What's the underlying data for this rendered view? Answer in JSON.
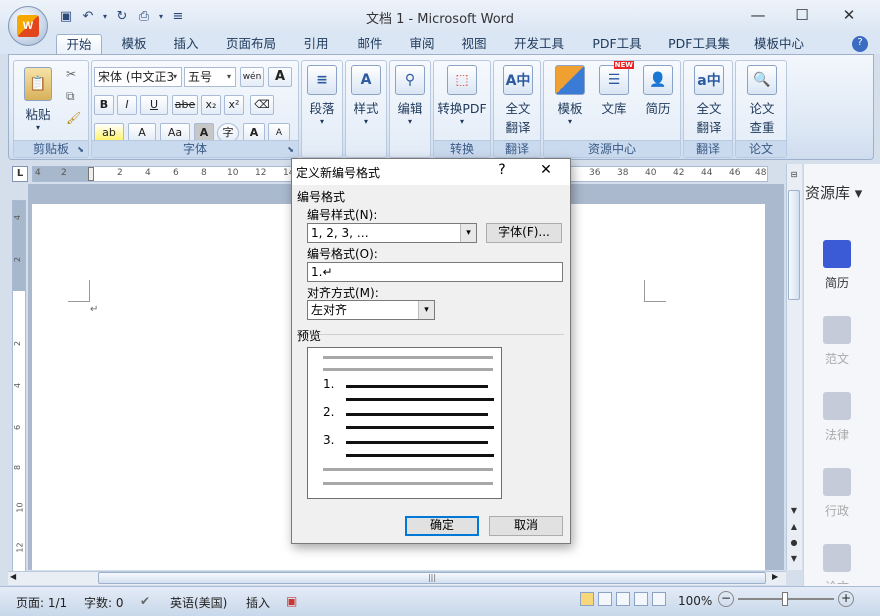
{
  "window": {
    "title": "文档 1 - Microsoft Word",
    "controls": [
      "—",
      "☐",
      "✕"
    ]
  },
  "office_button": {
    "logo": "W"
  },
  "quick_access": [
    "save-icon",
    "undo-icon",
    "redo-icon",
    "print-icon",
    "customize-icon"
  ],
  "tabs": [
    "开始",
    "模板",
    "插入",
    "页面布局",
    "引用",
    "邮件",
    "审阅",
    "视图",
    "开发工具",
    "PDF工具",
    "PDF工具集",
    "模板中心"
  ],
  "active_tab": "开始",
  "ribbon": {
    "clipboard": {
      "label": "剪贴板",
      "paste": "粘贴"
    },
    "font": {
      "label": "字体",
      "font_name": "宋体 (中文正3",
      "font_size": "五号",
      "wen": "wén",
      "bold": "B",
      "italic": "I",
      "underline": "U",
      "strike": "abe",
      "sub": "x₂",
      "sup": "x²",
      "aa": "Aa",
      "grow": "A",
      "shrink": "A"
    },
    "paragraph": {
      "label": "段落"
    },
    "styles": {
      "label": "样式"
    },
    "editing": {
      "label": "编辑"
    },
    "to_pdf": {
      "label": "转换",
      "button": "转换PDF"
    },
    "translate": {
      "label": "翻译",
      "button_line1": "全文",
      "button_line2": "翻译"
    },
    "resource": {
      "label": "资源中心",
      "template": "模板",
      "library": "文库",
      "resume": "简历",
      "new_badge": "NEW"
    },
    "translate2": {
      "label": "翻译",
      "button_line1": "全文",
      "button_line2": "翻译"
    },
    "paper": {
      "label": "论文",
      "button_line1": "论文",
      "button_line2": "查重"
    }
  },
  "ruler": {
    "corner": "L",
    "top_numbers": [
      "4",
      "2",
      "2",
      "4",
      "6",
      "8",
      "10",
      "12",
      "14",
      "36",
      "38",
      "40",
      "42",
      "44",
      "46",
      "48"
    ],
    "left_numbers": [
      "4",
      "2",
      "2",
      "4",
      "6",
      "8",
      "10",
      "12"
    ]
  },
  "document": {
    "paragraph_mark": "↵"
  },
  "resource_panel": {
    "title": "资源库",
    "items": [
      "简历",
      "范文",
      "法律",
      "行政",
      "论文"
    ]
  },
  "dialog": {
    "title": "定义新编号格式",
    "help": "?",
    "close": "✕",
    "section": "编号格式",
    "style_label": "编号样式(N):",
    "style_value": "1, 2, 3, …",
    "font_button": "字体(F)...",
    "format_label": "编号格式(O):",
    "format_value": "1.↵",
    "align_label": "对齐方式(M):",
    "align_value": "左对齐",
    "preview_label": "预览",
    "preview_numbers": [
      "1.",
      "2.",
      "3."
    ],
    "ok": "确定",
    "cancel": "取消"
  },
  "statusbar": {
    "page": "页面: 1/1",
    "words": "字数: 0",
    "language": "英语(美国)",
    "insert": "插入",
    "zoom": "100%"
  }
}
